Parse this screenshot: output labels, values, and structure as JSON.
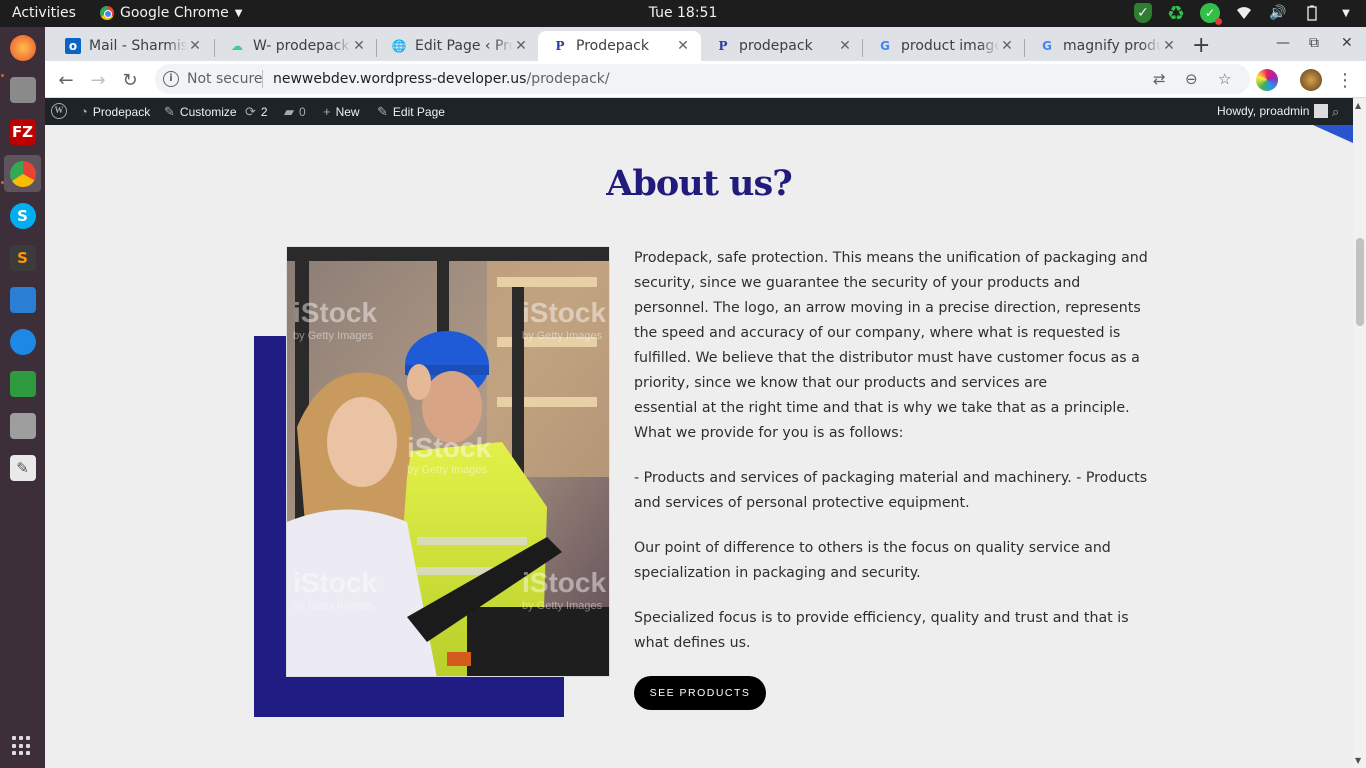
{
  "system": {
    "activities": "Activities",
    "app_name": "Google Chrome",
    "clock": "Tue 18:51"
  },
  "tabs": [
    {
      "label": "Mail - Sharmist",
      "favicon": "outlook-icon"
    },
    {
      "label": "W- prodepack",
      "favicon": "cloud-icon"
    },
    {
      "label": "Edit Page ‹ Pro",
      "favicon": "globe-icon"
    },
    {
      "label": "Prodepack",
      "favicon": "p-logo-icon",
      "active": true
    },
    {
      "label": "prodepack",
      "favicon": "p-logo-icon"
    },
    {
      "label": "product image",
      "favicon": "google-icon"
    },
    {
      "label": "magnify produc",
      "favicon": "google-icon"
    }
  ],
  "address_bar": {
    "security": "Not secure",
    "url_host": "newwebdev.wordpress-developer.us",
    "url_path": "/prodepack/"
  },
  "wp_admin_bar": {
    "site_name": "Prodepack",
    "customize": "Customize",
    "updates_count": "2",
    "comments_count": "0",
    "new_label": "New",
    "edit_page": "Edit Page",
    "greeting": "Howdy, proadmin"
  },
  "about": {
    "title": "About us?",
    "paragraph1": "Prodepack, safe protection. This means the unification of packaging and security, since we guarantee the security of your products and personnel. The logo, an arrow moving in a precise direction, represents the speed and accuracy of our company, where what is requested is fulfilled. We believe that the distributor must have customer focus as a priority, since we know that our products and services are",
    "paragraph1b": "essential at the right time and that is why we take that as a principle. What we provide for you is as follows:",
    "paragraph2": "- Products and services of packaging material and machinery. - Products and services of personal protective equipment.",
    "paragraph3": "Our point of difference to others is the focus on quality service and specialization in packaging and security.",
    "paragraph4": "Specialized focus is to provide efficiency, quality and trust and that is what defines us.",
    "button_label": "SEE PRODUCTS"
  },
  "photo": {
    "watermark": "iStock",
    "watermark_sub": "by Getty Images"
  },
  "colors": {
    "accent_navy": "#211c83",
    "title_color": "#211c7c",
    "corner_blue": "#2a55d0",
    "button_bg": "#000000"
  }
}
